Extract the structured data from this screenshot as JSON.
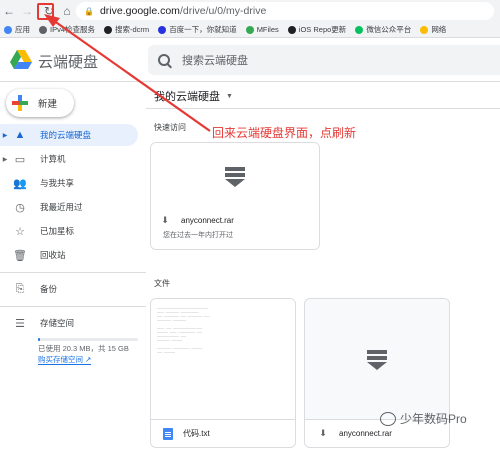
{
  "browser": {
    "url_host": "drive.google.com",
    "url_path": "/drive/u/0/my-drive"
  },
  "bookmarks": [
    {
      "label": "应用",
      "color": "#4285f4"
    },
    {
      "label": "IPv4检查服务",
      "color": "#5f6368"
    },
    {
      "label": "搜索-dcrm",
      "color": "#202124"
    },
    {
      "label": "百度一下，你就知道",
      "color": "#2932e1"
    },
    {
      "label": "MFiles",
      "color": "#34a853"
    },
    {
      "label": "iOS Repo更新",
      "color": "#202124"
    },
    {
      "label": "微信公众平台",
      "color": "#07c160"
    },
    {
      "label": "网络",
      "color": "#fbbc04"
    }
  ],
  "header": {
    "product_name": "云端硬盘",
    "search_placeholder": "搜索云端硬盘"
  },
  "sidebar": {
    "new_label": "新建",
    "items": [
      {
        "label": "我的云端硬盘",
        "icon": "drive-icon",
        "active": true
      },
      {
        "label": "计算机",
        "icon": "computer-icon",
        "active": false
      },
      {
        "label": "与我共享",
        "icon": "people-icon",
        "active": false
      },
      {
        "label": "我最近用过",
        "icon": "clock-icon",
        "active": false
      },
      {
        "label": "已加星标",
        "icon": "star-icon",
        "active": false
      },
      {
        "label": "回收站",
        "icon": "trash-icon",
        "active": false
      },
      {
        "label": "备份",
        "icon": "backup-icon",
        "active": false
      },
      {
        "label": "存储空间",
        "icon": "storage-icon",
        "active": false
      }
    ],
    "storage_used": "已使用 20.3 MB，共 15 GB",
    "storage_fraction": 0.0013,
    "buy_storage": "购买存储空间"
  },
  "main": {
    "breadcrumb": "我的云端硬盘",
    "quick_access_title": "快速访问",
    "quick_access": [
      {
        "name": "anyconnect.rar",
        "subtitle": "您在过去一年内打开过"
      }
    ],
    "files_title": "文件",
    "files": [
      {
        "name": "代码.txt",
        "type": "text"
      },
      {
        "name": "anyconnect.rar",
        "type": "archive"
      }
    ]
  },
  "annotation": {
    "text": "回来云端硬盘界面，点刷新",
    "color": "#e53935"
  },
  "watermark": {
    "text": "少年数码Pro"
  }
}
